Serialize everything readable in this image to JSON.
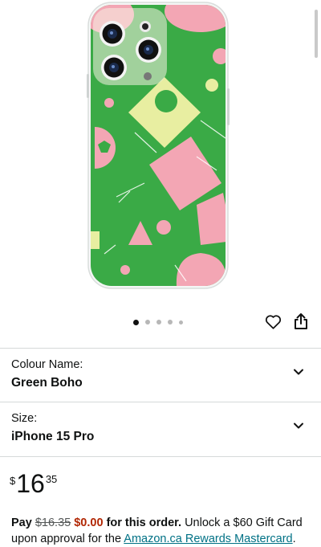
{
  "colors": {
    "case_green": "#3aaa46",
    "case_pink": "#f3a6b4",
    "case_yellow": "#e8eea1",
    "price_red": "#b12704",
    "link_teal": "#007185"
  },
  "gallery": {
    "image_count": 5,
    "active_index": 0
  },
  "icons": {
    "wishlist": "heart-outline-icon",
    "share": "share-icon",
    "expand": "chevron-down-icon"
  },
  "variations": {
    "colour": {
      "label": "Colour Name:",
      "value": "Green Boho"
    },
    "size": {
      "label": "Size:",
      "value": "iPhone 15 Pro"
    }
  },
  "price": {
    "symbol": "$",
    "whole": "16",
    "fraction": "35"
  },
  "promo": {
    "pay": "Pay",
    "original": "$16.35",
    "discounted": "$0.00",
    "for_order": "for this order.",
    "unlock": "Unlock a $60 Gift Card upon approval for the",
    "link": "Amazon.ca Rewards Mastercard",
    "end": "."
  }
}
